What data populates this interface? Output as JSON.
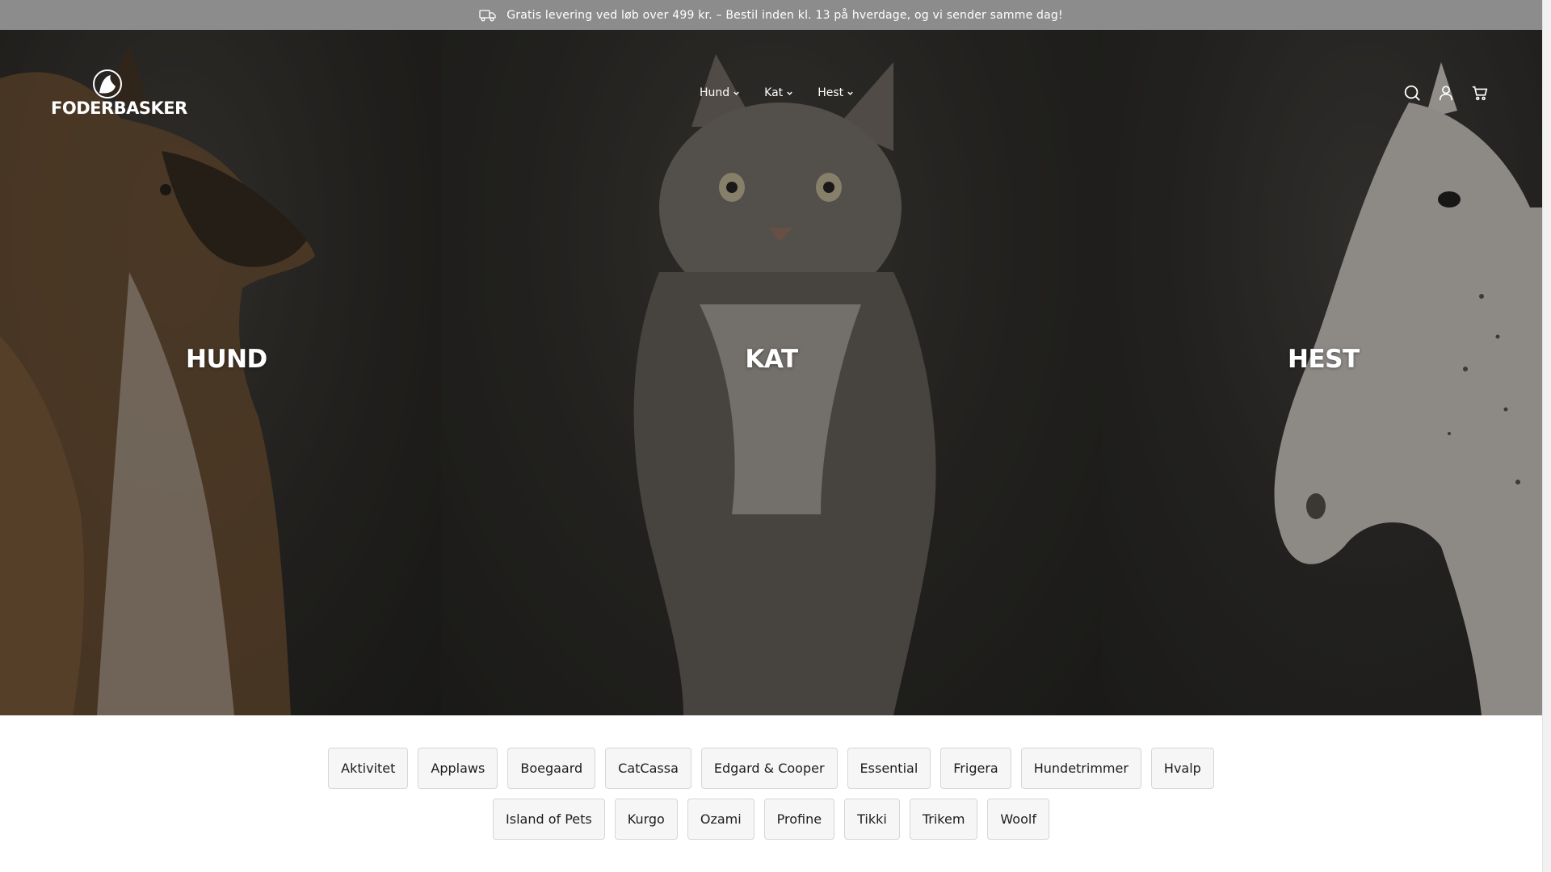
{
  "announcement": {
    "text": "Gratis levering ved løb over 499 kr. – Bestil inden kl. 13 på hverdage, og vi sender samme dag!",
    "icon": "truck-icon"
  },
  "header": {
    "logo_text": "FODERBASKER",
    "nav": [
      {
        "label": "Hund"
      },
      {
        "label": "Kat"
      },
      {
        "label": "Hest"
      }
    ],
    "icons": [
      "search-icon",
      "account-icon",
      "cart-icon"
    ]
  },
  "hero": {
    "panels": [
      {
        "label": "HUND",
        "image": "german-shepherd-dog"
      },
      {
        "label": "KAT",
        "image": "long-haired-cat"
      },
      {
        "label": "HEST",
        "image": "white-dappled-horse"
      }
    ]
  },
  "brands": {
    "row1": [
      "Aktivitet",
      "Applaws",
      "Boegaard",
      "CatCassa",
      "Edgard & Cooper",
      "Essential",
      "Frigera",
      "Hundetrimmer",
      "Hvalp"
    ],
    "row2": [
      "Island of Pets",
      "Kurgo",
      "Ozami",
      "Profine",
      "Tikki",
      "Trikem",
      "Woolf"
    ]
  },
  "colors": {
    "announcement_bg": "#8d8c8c",
    "hero_overlay": "#1e1c1b",
    "chip_bg": "#f6f6f6",
    "chip_border": "#d6d6d6",
    "text_dark": "#1d1d1d"
  }
}
